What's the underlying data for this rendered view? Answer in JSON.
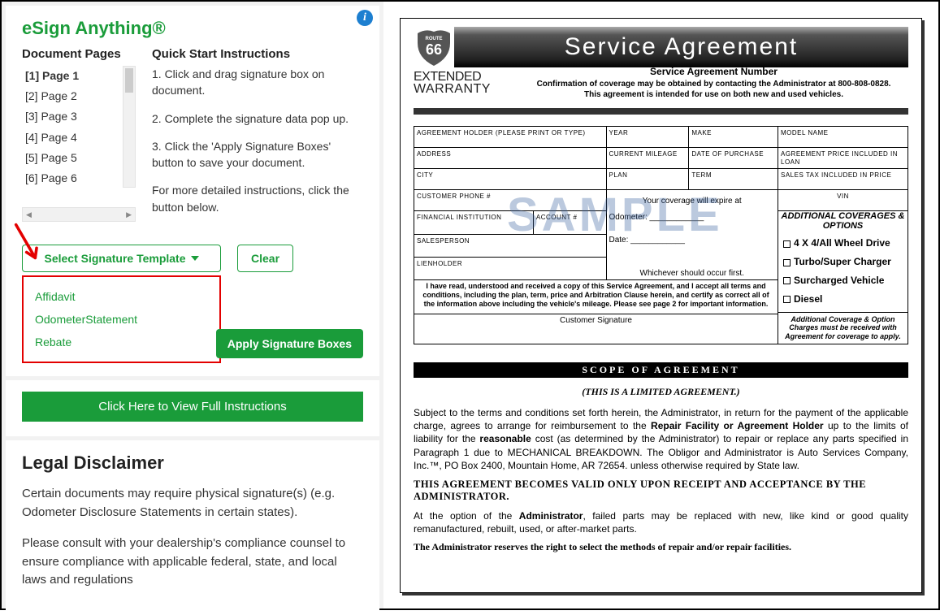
{
  "esign": {
    "title": "eSign Anything®",
    "pages_heading": "Document Pages",
    "pages": [
      "[1] Page 1",
      "[2] Page 2",
      "[3] Page 3",
      "[4] Page 4",
      "[5] Page 5",
      "[6] Page 6"
    ],
    "pages_selected_index": 0,
    "instr_heading": "Quick Start Instructions",
    "instr_1": "1. Click and drag signature box on document.",
    "instr_2": "2. Complete the signature data pop up.",
    "instr_3": "3. Click the 'Apply Signature Boxes' button to save your document.",
    "instr_more": "For more detailed instructions, click the button below.",
    "template_btn": "Select Signature Template",
    "clear_btn": "Clear",
    "template_options": [
      "Affidavit",
      "OdometerStatement",
      "Rebate"
    ],
    "apply_btn": "Apply Signature Boxes",
    "full_instructions_btn": "Click Here to View Full Instructions"
  },
  "legal": {
    "heading": "Legal Disclaimer",
    "p1": "Certain documents may require physical signature(s) (e.g. Odometer Disclosure Statements in certain states).",
    "p2": "Please consult with your dealership's compliance counsel to ensure compliance with applicable federal, state, and local laws and regulations"
  },
  "doc": {
    "title": "Service Agreement",
    "ext1": "EXTENDED",
    "ext2": "WARRANTY",
    "san_label": "Service Agreement Number",
    "conf1": "Confirmation of coverage may be obtained by contacting the Administrator at 800-808-0828.",
    "conf2": "This agreement is intended for use on both new and used vehicles.",
    "watermark": "SAMPLE",
    "fields": {
      "holder": "AGREEMENT HOLDER (PLEASE PRINT OR TYPE)",
      "year": "YEAR",
      "make": "MAKE",
      "model": "MODEL NAME",
      "address": "ADDRESS",
      "mileage": "CURRENT MILEAGE",
      "dop": "DATE OF PURCHASE",
      "price_loan": "AGREEMENT PRICE INCLUDED IN LOAN",
      "city": "CITY",
      "plan": "PLAN",
      "term": "TERM",
      "tax": "SALES TAX INCLUDED IN PRICE",
      "phone": "CUSTOMER PHONE #",
      "expire": "Your coverage will expire at",
      "vin": "VIN",
      "fin": "FINANCIAL INSTITUTION",
      "acct": "ACCOUNT #",
      "odo": "Odometer:",
      "salesperson": "SALESPERSON",
      "date": "Date:",
      "lien": "LIENHOLDER",
      "which": "Whichever should occur first.",
      "cert": "I have read, understood and received a copy of this Service Agreement, and I accept all terms and conditions, including the plan, term, price and Arbitration Clause herein, and certify as correct all of the information above including the vehicle's mileage.  Please see page 2 for important information.",
      "sig": "Customer Signature"
    },
    "options": {
      "head": "ADDITIONAL COVERAGES & OPTIONS",
      "o1": "4 X 4/All Wheel Drive",
      "o2": "Turbo/Super Charger",
      "o3": "Surcharged Vehicle",
      "o4": "Diesel",
      "foot": "Additional Coverage & Option Charges must be received with Agreement for coverage to apply."
    },
    "scope": {
      "bar": "SCOPE OF AGREEMENT",
      "limited": "(THIS IS A LIMITED AGREEMENT.)",
      "p1a": "Subject to the terms and conditions set forth herein, the Administrator, in return for the payment of the applicable charge, agrees to arrange for reimbursement to the ",
      "p1b": "Repair Facility or Agreement Holder",
      "p1c": " up to the limits of liability for the ",
      "p1d": "reasonable",
      "p1e": " cost (as determined by the Administrator) to repair or replace any parts specified in Paragraph 1 due to MECHANICAL BREAKDOWN. The Obligor and Administrator is Auto Services Company, Inc.™, PO Box 2400, Mountain Home, AR  72654. unless otherwise required by State law.",
      "valid": "THIS AGREEMENT BECOMES VALID ONLY UPON RECEIPT AND ACCEPTANCE BY THE ADMINISTRATOR.",
      "p2a": "At the option of the ",
      "p2b": "Administrator",
      "p2c": ", failed parts may be replaced with new, like kind or good quality remanufactured, rebuilt, used, or after-market parts.",
      "p3": "The Administrator reserves the right to select the methods of repair and/or repair facilities."
    }
  }
}
